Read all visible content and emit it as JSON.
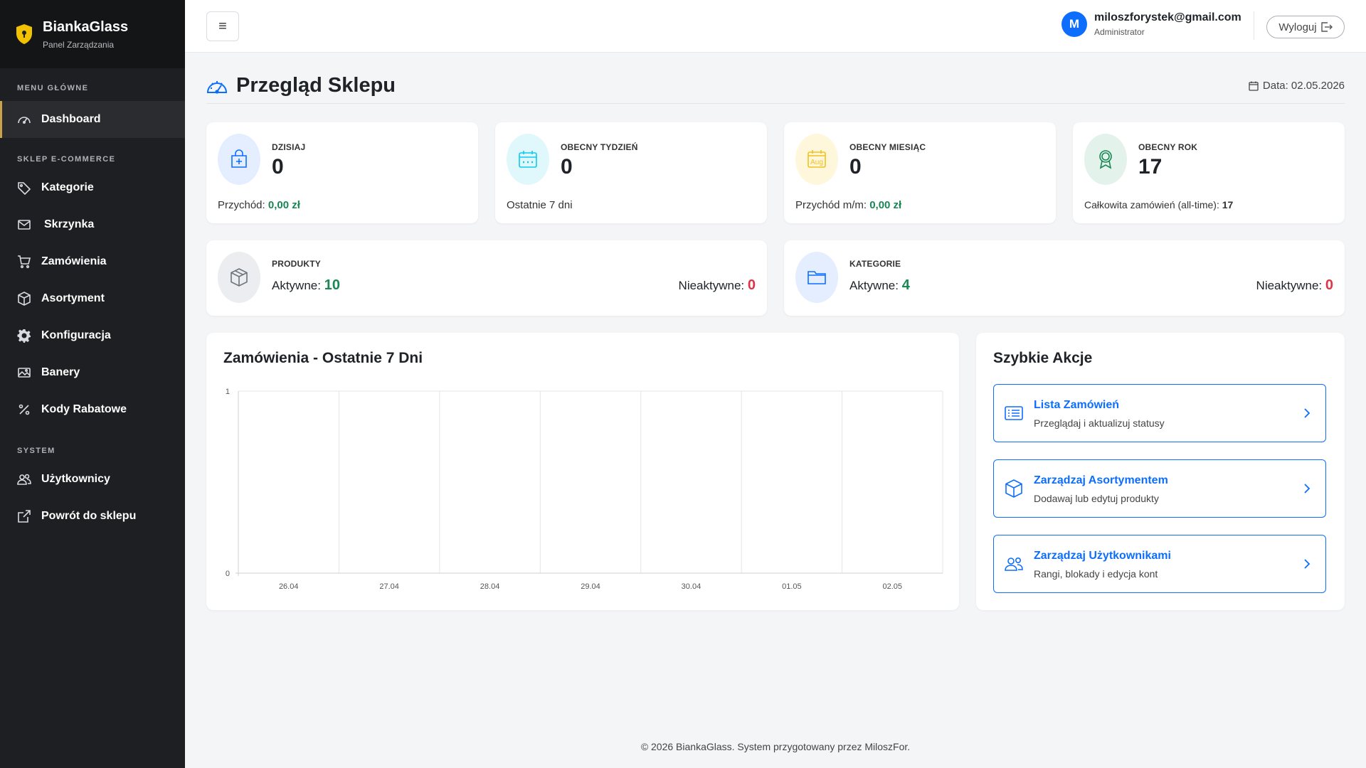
{
  "brand": {
    "title": "BiankaGlass",
    "subtitle": "Panel Zarządzania"
  },
  "sidebar": {
    "sections": {
      "main": "MENU GŁÓWNE",
      "shop": "SKLEP E-COMMERCE",
      "system": "SYSTEM"
    },
    "items": [
      {
        "label": "Dashboard",
        "icon": "dashboard-gauge-icon"
      },
      {
        "label": "Kategorie",
        "icon": "tag-icon"
      },
      {
        "label": "Skrzynka",
        "icon": "envelope-icon"
      },
      {
        "label": "Zamówienia",
        "icon": "cart-icon"
      },
      {
        "label": "Asortyment",
        "icon": "box-icon"
      },
      {
        "label": "Konfiguracja",
        "icon": "gear-icon"
      },
      {
        "label": "Banery",
        "icon": "image-icon"
      },
      {
        "label": "Kody Rabatowe",
        "icon": "percent-icon"
      },
      {
        "label": "Użytkownicy",
        "icon": "people-icon"
      },
      {
        "label": "Powrót do sklepu",
        "icon": "external-link-icon"
      }
    ],
    "accent": "#c9a24a"
  },
  "header": {
    "menu_symbol": "≡",
    "user": {
      "initial": "M",
      "email": "miloszforystek@gmail.com",
      "role": "Administrator"
    },
    "logout_label": "Wyloguj"
  },
  "page": {
    "title": "Przegląd Sklepu",
    "date_label": "Data: 02.05.2026"
  },
  "stats": {
    "today": {
      "label": "DZISIAJ",
      "value": "0",
      "foot_prefix": "Przychód: ",
      "foot_value": "0,00 zł"
    },
    "week": {
      "label": "OBECNY TYDZIEŃ",
      "value": "0",
      "foot": "Ostatnie 7 dni"
    },
    "month": {
      "label": "OBECNY MIESIĄC",
      "value": "0",
      "foot_prefix": "Przychód m/m: ",
      "foot_value": "0,00 zł",
      "icon_text": "Aug"
    },
    "year": {
      "label": "OBECNY ROK",
      "value": "17",
      "foot_prefix": "Całkowita zamówień (all-time): ",
      "foot_value": "17"
    }
  },
  "products": {
    "label": "PRODUKTY",
    "active_label": "Aktywne: ",
    "active": "10",
    "inactive_label": "Nieaktywne: ",
    "inactive": "0"
  },
  "categories": {
    "label": "KATEGORIE",
    "active_label": "Aktywne: ",
    "active": "4",
    "inactive_label": "Nieaktywne: ",
    "inactive": "0"
  },
  "chart_panel": {
    "title": "Zamówienia - Ostatnie 7 Dni"
  },
  "chart_data": {
    "type": "line",
    "title": "Zamówienia - Ostatnie 7 Dni",
    "categories": [
      "26.04",
      "27.04",
      "28.04",
      "29.04",
      "30.04",
      "01.05",
      "02.05"
    ],
    "values": [
      0,
      0,
      0,
      0,
      0,
      0,
      0
    ],
    "ylim": [
      0,
      1
    ],
    "yticks": [
      "0",
      "1"
    ],
    "grid": true
  },
  "quick_actions": {
    "title": "Szybkie Akcje",
    "items": [
      {
        "title": "Lista Zamówień",
        "subtitle": "Przeglądaj i aktualizuj statusy",
        "icon": "list-icon"
      },
      {
        "title": "Zarządzaj Asortymentem",
        "subtitle": "Dodawaj lub edytuj produkty",
        "icon": "box-icon"
      },
      {
        "title": "Zarządzaj Użytkownikami",
        "subtitle": "Rangi, blokady i edycja kont",
        "icon": "people-icon"
      }
    ]
  },
  "footer": {
    "text": "© 2026 BiankaGlass. System przygotowany przez MiloszFor."
  },
  "colors": {
    "primary": "#0d6efd",
    "success": "#198754",
    "danger": "#dc3545",
    "sidebar_bg": "#1d1f22"
  }
}
